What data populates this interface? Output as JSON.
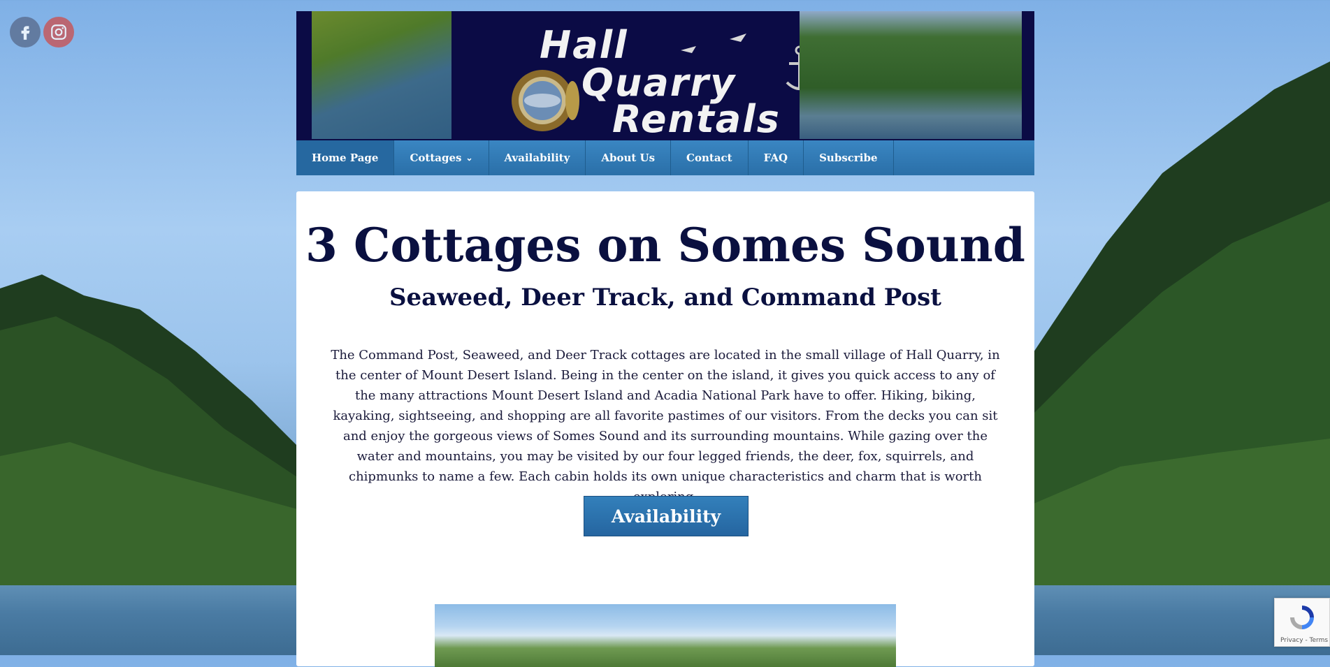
{
  "social": {
    "facebook_icon": "facebook-icon",
    "instagram_icon": "instagram-icon"
  },
  "banner": {
    "logo_line1": "Hall",
    "logo_line2": "Quarry",
    "logo_line3": "Rentals"
  },
  "nav": {
    "items": [
      {
        "label": "Home Page",
        "active": true
      },
      {
        "label": "Cottages",
        "has_dropdown": true
      },
      {
        "label": "Availability"
      },
      {
        "label": "About Us"
      },
      {
        "label": "Contact"
      },
      {
        "label": "FAQ"
      },
      {
        "label": "Subscribe"
      }
    ]
  },
  "main": {
    "title": "3 Cottages on Somes Sound",
    "subtitle": "Seaweed, Deer Track, and Command Post",
    "description": "The Command Post, Seaweed, and Deer Track cottages are located in the small village of Hall Quarry, in the center of Mount Desert Island. Being in the center on the island, it gives you quick access to any of the many attractions Mount Desert Island and Acadia National Park have to offer. Hiking, biking, kayaking, sightseeing, and shopping are all favorite pastimes of our visitors. From the decks you can sit and enjoy the gorgeous views of Somes Sound and its surrounding mountains. While gazing over the water and mountains, you may be visited by our four legged friends, the deer, fox, squirrels, and chipmunks to name a few. Each cabin holds its own unique characteristics and charm that is worth exploring.",
    "cta_label": "Availability"
  },
  "recaptcha": {
    "text": "Privacy - Terms"
  },
  "colors": {
    "nav_bg": "#2a6fa8",
    "heading": "#0a1040",
    "banner_bg": "#0b0b45"
  }
}
